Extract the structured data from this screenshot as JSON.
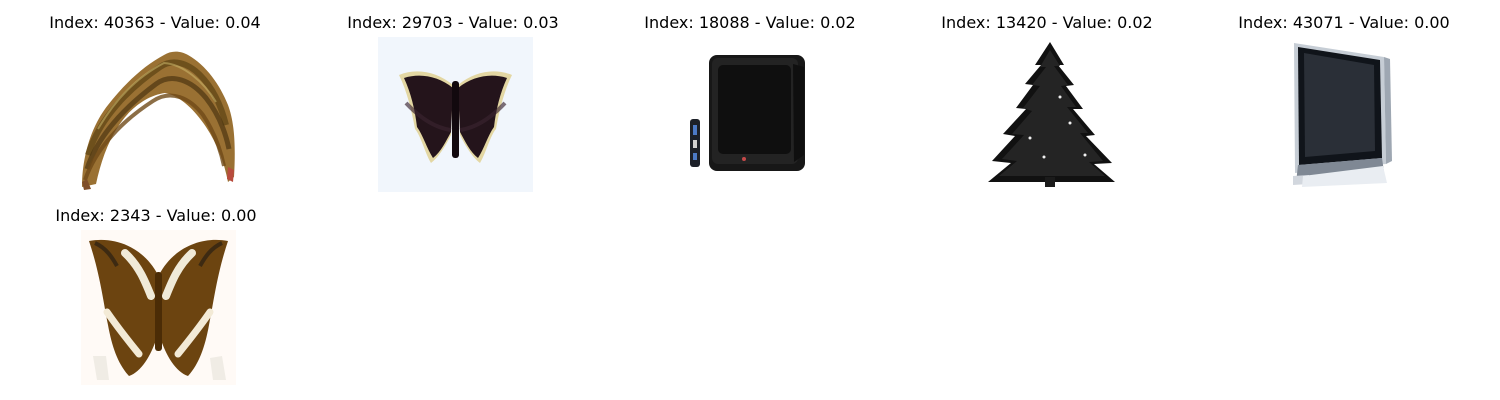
{
  "tiles": [
    {
      "title": "Index: 40363 - Value: 0.04",
      "image": "caterpillar"
    },
    {
      "title": "Index: 29703 - Value: 0.03",
      "image": "dark-butterfly"
    },
    {
      "title": "Index: 18088 - Value: 0.02",
      "image": "crt-television-with-remote"
    },
    {
      "title": "Index: 13420 - Value: 0.02",
      "image": "pine-tree"
    },
    {
      "title": "Index: 43071 - Value: 0.00",
      "image": "flat-screen-television"
    },
    {
      "title": "Index: 2343 - Value: 0.00",
      "image": "brown-butterfly"
    }
  ],
  "colors": {
    "background": "#ffffff",
    "text": "#000000"
  }
}
